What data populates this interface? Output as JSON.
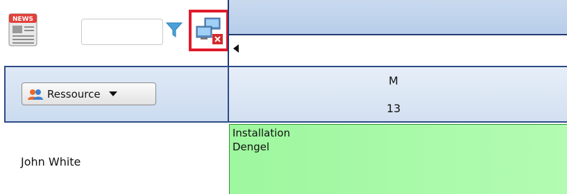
{
  "toolbar": {
    "filter_placeholder": "",
    "news_icon": "newspaper-icon",
    "filter_icon": "funnel-icon",
    "network_icon": "network-disconnect-icon",
    "highlight_color": "#e2192b"
  },
  "header": {
    "resource_button_label": "Ressource",
    "day_letter": "M",
    "day_number": "13"
  },
  "rows": [
    {
      "resource": "John White",
      "booking_line1": "Installation",
      "booking_line2": "Dengel",
      "booking_color": "#a6f9a6"
    }
  ]
}
